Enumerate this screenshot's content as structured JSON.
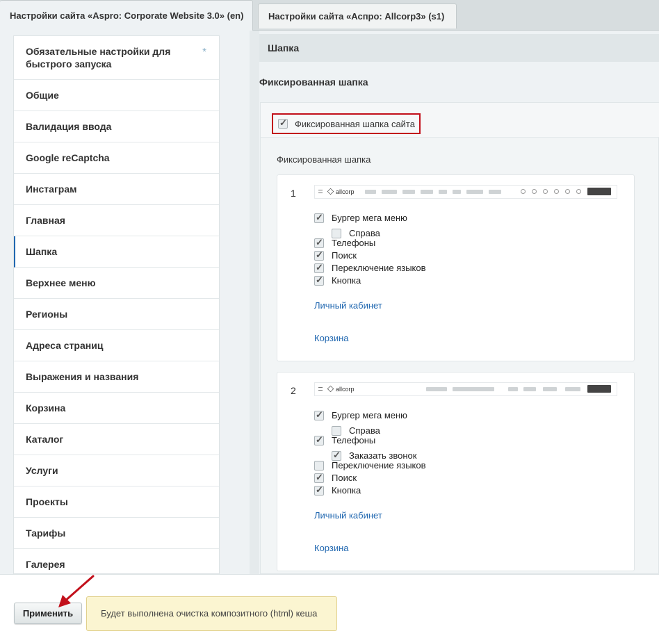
{
  "tabs": [
    {
      "label": "Настройки сайта «Aspro: Corporate Website 3.0» (en)",
      "active": true
    },
    {
      "label": "Настройки сайта «Аспро: Allcorp3» (s1)",
      "active": false
    }
  ],
  "sidebar": {
    "items": [
      {
        "label": "Обязательные настройки для быстрого запуска",
        "marker": "*"
      },
      {
        "label": "Общие"
      },
      {
        "label": "Валидация ввода"
      },
      {
        "label": "Google reCaptcha"
      },
      {
        "label": "Инстаграм"
      },
      {
        "label": "Главная"
      },
      {
        "label": "Шапка",
        "active": true
      },
      {
        "label": "Верхнее меню"
      },
      {
        "label": "Регионы"
      },
      {
        "label": "Адреса страниц"
      },
      {
        "label": "Выражения и названия"
      },
      {
        "label": "Корзина"
      },
      {
        "label": "Каталог"
      },
      {
        "label": "Услуги"
      },
      {
        "label": "Проекты"
      },
      {
        "label": "Тарифы"
      },
      {
        "label": "Галерея"
      }
    ]
  },
  "main": {
    "section_title": "Шапка",
    "subsection_title": "Фиксированная шапка",
    "fixed_header_checkbox": {
      "label": "Фиксированная шапка сайта",
      "checked": true,
      "highlight_color": "#c2101b"
    },
    "inner_title": "Фиксированная шапка",
    "variants": [
      {
        "number": "1",
        "preview_logo": "allcorp",
        "options": [
          {
            "label": "Бургер мега меню",
            "checked": true
          },
          {
            "label": "Справа",
            "checked": false
          },
          {
            "label": "Телефоны",
            "checked": true
          },
          {
            "label": "Поиск",
            "checked": true
          },
          {
            "label": "Переключение языков",
            "checked": true
          },
          {
            "label": "Кнопка",
            "checked": true
          }
        ],
        "links": [
          "Личный кабинет",
          "Корзина"
        ]
      },
      {
        "number": "2",
        "preview_logo": "allcorp",
        "options": [
          {
            "label": "Бургер мега меню",
            "checked": true
          },
          {
            "label": "Справа",
            "checked": false
          },
          {
            "label": "Телефоны",
            "checked": true
          },
          {
            "label": "Заказать звонок",
            "checked": true
          },
          {
            "label": "Переключение языков",
            "checked": false
          },
          {
            "label": "Поиск",
            "checked": true
          },
          {
            "label": "Кнопка",
            "checked": true
          }
        ],
        "links": [
          "Личный кабинет",
          "Корзина"
        ]
      }
    ]
  },
  "footer": {
    "apply_label": "Применить",
    "notice": "Будет выполнена очистка композитного (html) кеша"
  },
  "colors": {
    "accent": "#2067b0",
    "highlight": "#c2101b",
    "notice_bg": "#fbf5d1"
  },
  "icons": {
    "checkbox": "check-icon",
    "arrow": "red-arrow-icon"
  }
}
